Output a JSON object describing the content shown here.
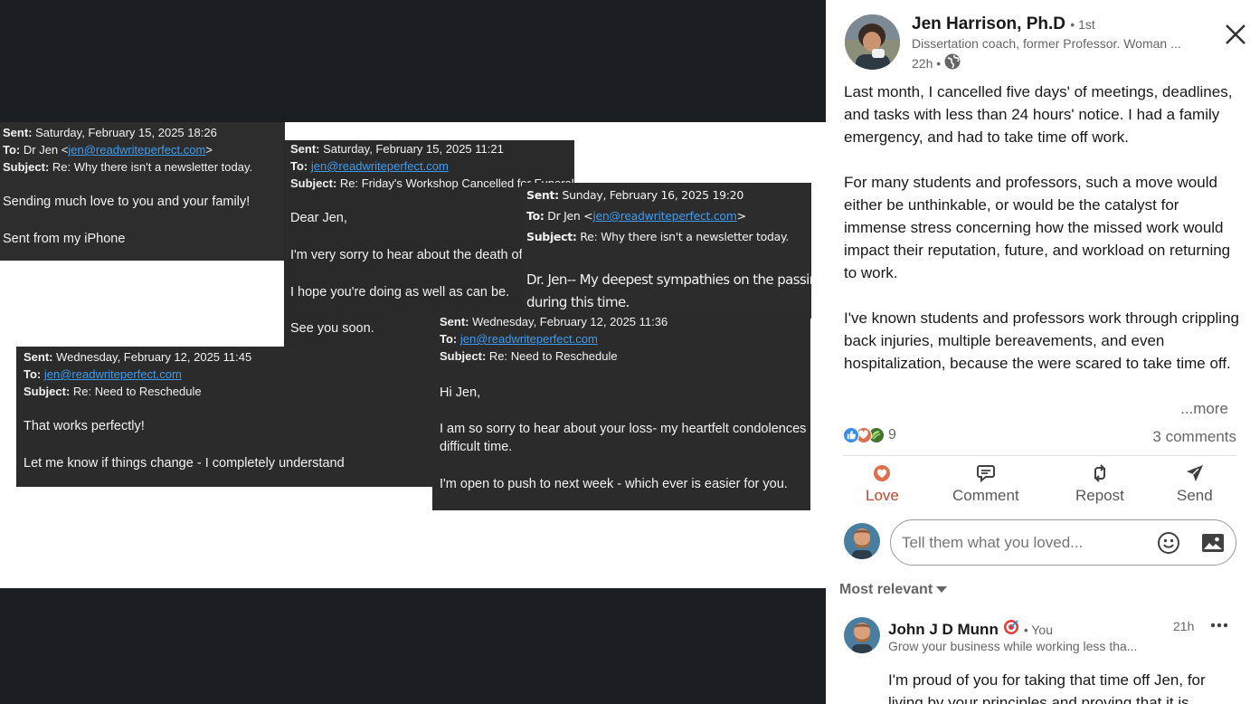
{
  "emails": [
    {
      "sent_label": "Sent:",
      "sent": "Saturday, February 15, 2025 18:26",
      "to_label": "To:",
      "to_prefix": "Dr Jen <",
      "to_link": "jen@readwriteperfect.com",
      "to_suffix": ">",
      "subject_label": "Subject:",
      "subject": "Re: Why there isn't a newsletter today.",
      "body": [
        "Sending much love to you and your family!",
        "Sent from my iPhone"
      ]
    },
    {
      "sent_label": "Sent:",
      "sent": "Saturday, February 15, 2025 11:21",
      "to_label": "To:",
      "to_link": "jen@readwriteperfect.com",
      "subject_label": "Subject:",
      "subject": "Re: Friday's Workshop Cancelled for Funeral",
      "body": [
        "Dear Jen,",
        "I'm very sorry to hear about the death of",
        "I hope you're doing as well as can be.",
        "See you soon."
      ]
    },
    {
      "sent_label": "Sent:",
      "sent": "Sunday, February 16, 2025 19:20",
      "to_label": "To:",
      "to_prefix": "Dr Jen <",
      "to_link": "jen@readwriteperfect.com",
      "to_suffix": ">",
      "subject_label": "Subject:",
      "subject": "Re: Why there isn't a newsletter today.",
      "body": [
        "Dr. Jen-- My deepest sympathies on the passing",
        "during this time."
      ]
    },
    {
      "sent_label": "Sent:",
      "sent": "Wednesday, February 12, 2025 11:45",
      "to_label": "To:",
      "to_link": "jen@readwriteperfect.com",
      "subject_label": "Subject:",
      "subject": "Re: Need to Reschedule",
      "body": [
        "That works perfectly!",
        "Let me know if things change - I completely understand"
      ]
    },
    {
      "sent_label": "Sent:",
      "sent": "Wednesday, February 12, 2025 11:36",
      "to_label": "To:",
      "to_link": "jen@readwriteperfect.com",
      "subject_label": "Subject:",
      "subject": "Re: Need to Reschedule",
      "body": [
        "Hi Jen,",
        "I am so sorry to hear about your loss- my heartfelt condolences",
        "difficult time.",
        "I'm open to push to next week - which ever is easier for you."
      ]
    }
  ],
  "post": {
    "author_name": "Jen Harrison, Ph.D",
    "connection": "• 1st",
    "headline": "Dissertation coach, former Professor. Woman ...",
    "time": "22h •",
    "paragraphs": [
      "Last month, I cancelled five days' of meetings, deadlines, and tasks with less than 24 hours' notice. I had a family emergency, and had to take time off work.",
      "For many students and professors, such a move would either be unthinkable, or would be the catalyst for immense stress concerning how the missed work would impact their reputation, future, and workload on returning to work.",
      "I've known students and professors work through crippling back injuries, multiple bereavements, and even hospitalization, because the were scared to take time off."
    ],
    "more": "...more",
    "reaction_count": "9",
    "comments_count": "3 comments",
    "actions": {
      "love": "Love",
      "comment": "Comment",
      "repost": "Repost",
      "send": "Send"
    },
    "comment_placeholder": "Tell them what you loved...",
    "sort_label": "Most relevant"
  },
  "comment": {
    "author": "John J D Munn",
    "you": "• You",
    "headline": "Grow your business while working less tha...",
    "time": "21h",
    "text": "I'm proud of you for taking that time off Jen, for living by your principles and proving that it is"
  },
  "colors": {
    "love": "#c4452d",
    "link": "#3d9cf0",
    "email_bg": "#2b2b2b",
    "page_bg": "#1b1f23"
  },
  "icons": [
    "close-icon",
    "globe-icon",
    "like-reaction-icon",
    "love-reaction-icon",
    "support-reaction-icon",
    "love-icon",
    "comment-icon",
    "repost-icon",
    "send-icon",
    "emoji-icon",
    "image-icon",
    "caret-down-icon",
    "more-icon",
    "goal-emoji-icon"
  ]
}
